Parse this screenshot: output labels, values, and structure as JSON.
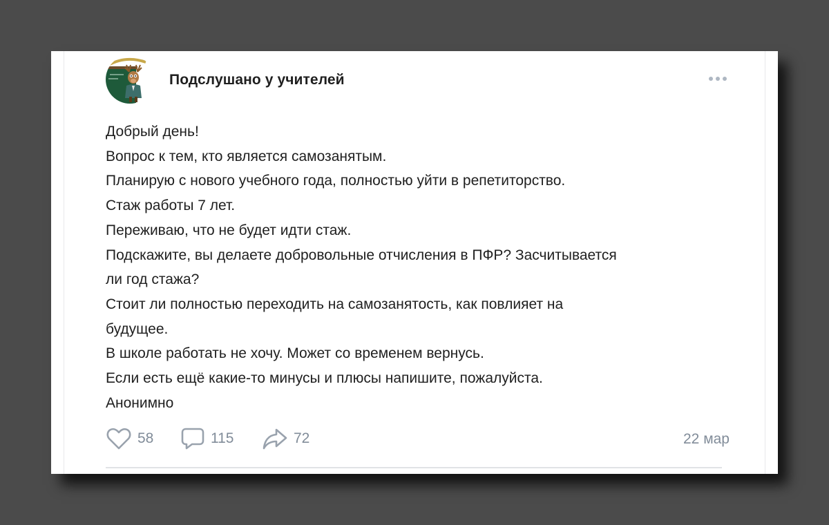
{
  "group": {
    "name": "Подслушано у учителей"
  },
  "post": {
    "lines": [
      "Добрый день!",
      "Вопрос к тем, кто является самозанятым.",
      "Планирую с нового учебного года, полностью уйти в репетиторство.",
      "Стаж работы 7 лет.",
      "Переживаю, что не будет идти стаж.",
      "Подскажите, вы делаете добровольные отчисления в ПФР? Засчитывается",
      "ли год стажа?",
      "Стоит ли полностью переходить на самозанятость, как повлияет на",
      "будущее.",
      "В школе работать не хочу. Может со временем вернусь.",
      "Если есть ещё какие-то минусы и плюсы напишите, пожалуйста.",
      "Анонимно"
    ]
  },
  "actions": {
    "likes": "58",
    "comments": "115",
    "shares": "72"
  },
  "date": "22 мар",
  "colors": {
    "background": "#4b4b4b",
    "card": "#ffffff",
    "text": "#1f1f1f",
    "muted": "#818c99",
    "avatar_board": "#1e5a3a"
  },
  "icons": [
    "more-icon",
    "heart-icon",
    "comment-icon",
    "share-icon"
  ]
}
